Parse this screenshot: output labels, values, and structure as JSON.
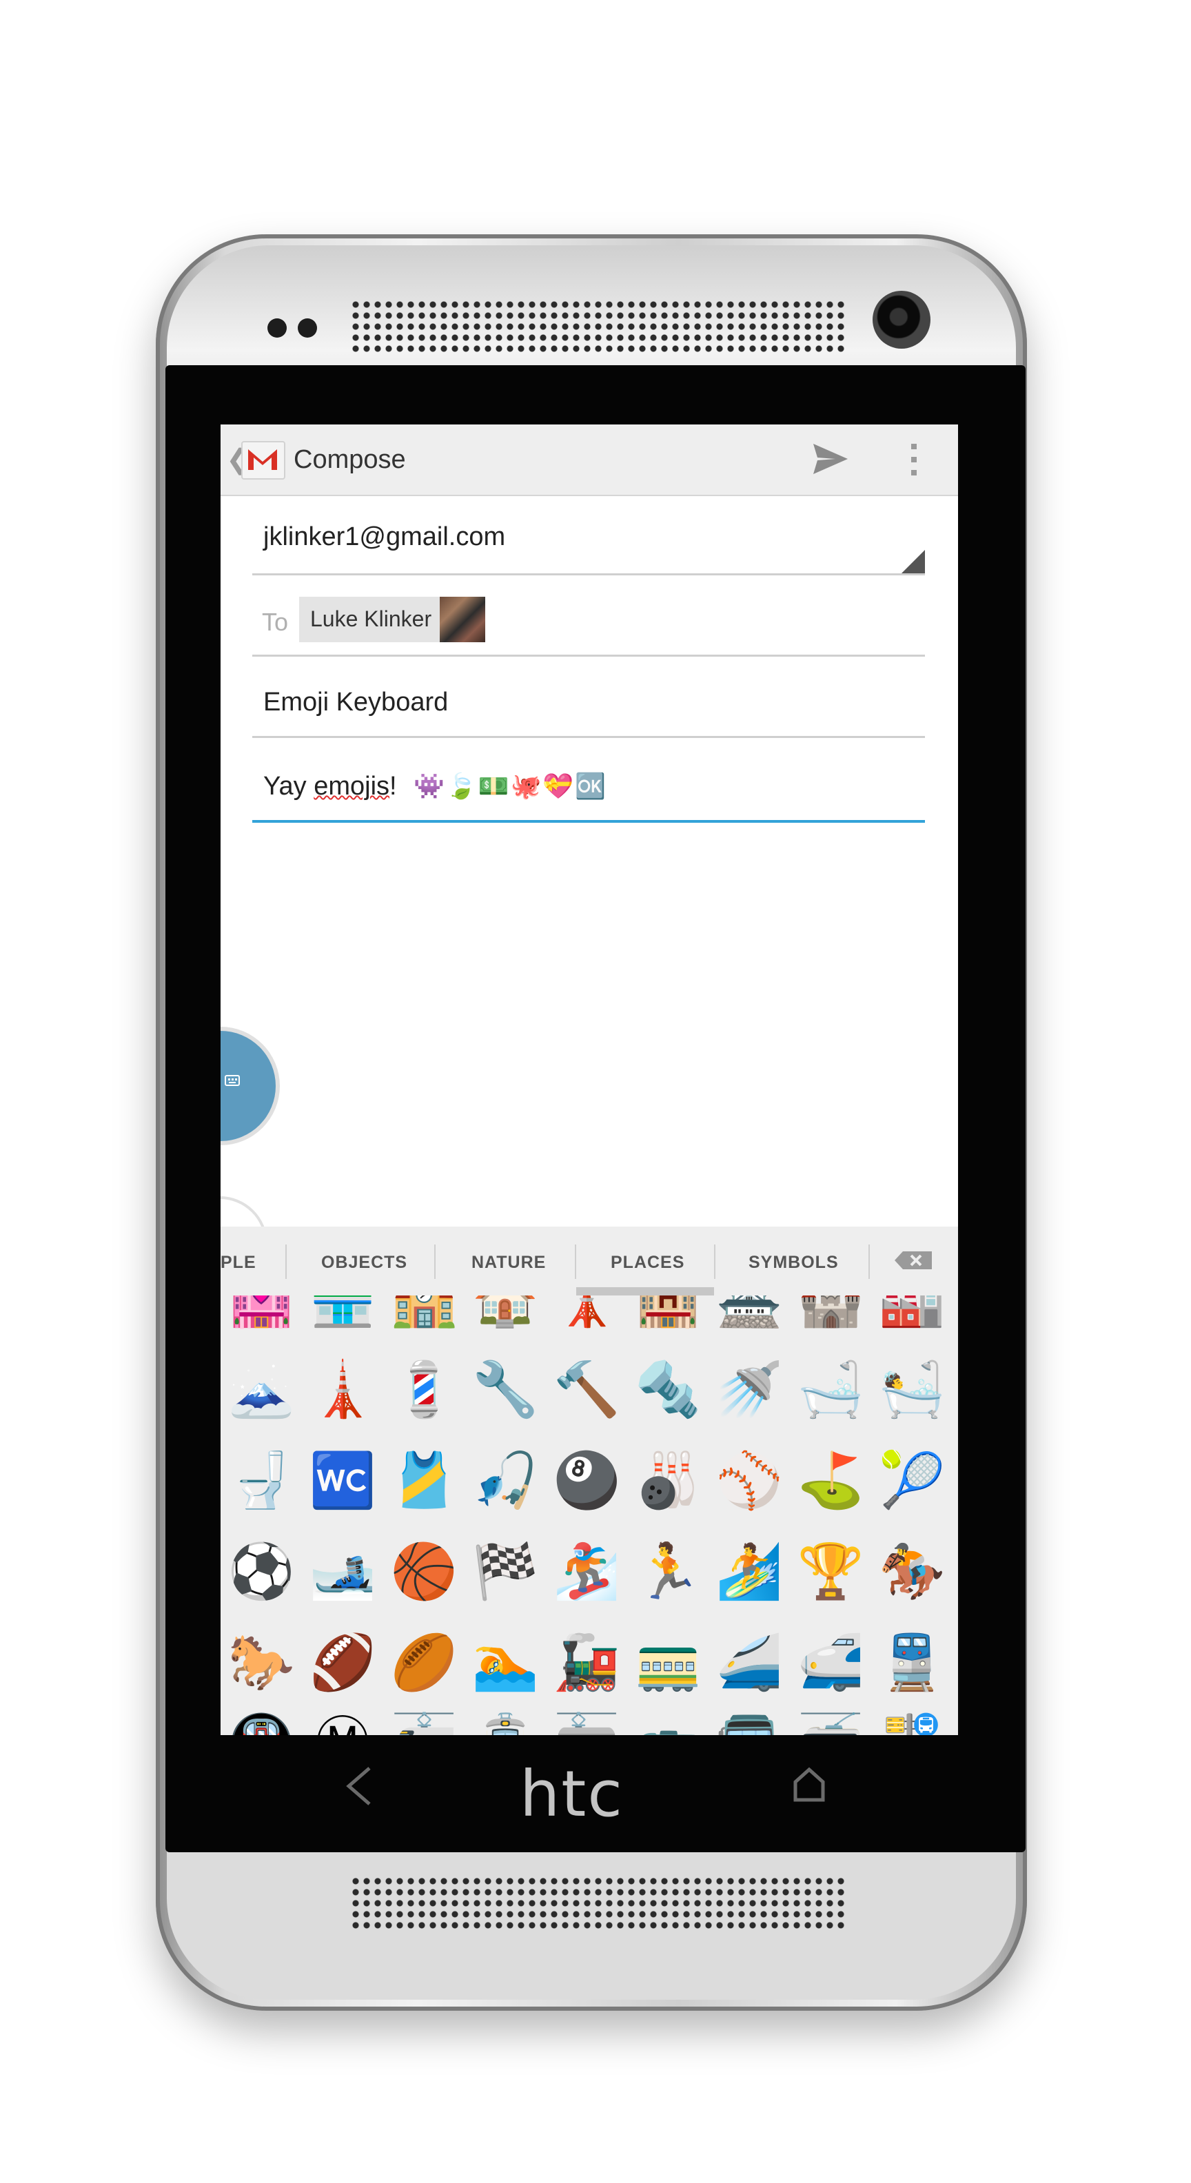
{
  "app": {
    "title": "Compose"
  },
  "compose": {
    "from": "jklinker1@gmail.com",
    "to_label": "To",
    "recipient_chip": "Luke Klinker",
    "subject": "Emoji Keyboard",
    "body_prefix": "Yay ",
    "body_misspelled": "emojis",
    "body_suffix": "!",
    "body_emojis": "👾🍃💵🐙💝🆗"
  },
  "keyboard": {
    "tabs": [
      "PLE",
      "OBJECTS",
      "NATURE",
      "PLACES",
      "SYMBOLS"
    ],
    "selected_tab": "PLACES",
    "emoji_rows": [
      [
        "🏩",
        "🏪",
        "🏫",
        "🏠",
        "🗼",
        "🏨",
        "🏯",
        "🏰",
        "🏭"
      ],
      [
        "🗻",
        "🗼",
        "💈",
        "🔧",
        "🔨",
        "🔩",
        "🚿",
        "🛁",
        "🛀"
      ],
      [
        "🚽",
        "🚾",
        "🎽",
        "🎣",
        "🎱",
        "🎳",
        "⚾",
        "⛳",
        "🎾"
      ],
      [
        "⚽",
        "🎿",
        "🏀",
        "🏁",
        "🏂",
        "🏃",
        "🏄",
        "🏆",
        "🏇"
      ],
      [
        "🐎",
        "🏈",
        "🏉",
        "🏊",
        "🚂",
        "🚃",
        "🚄",
        "🚅",
        "🚆"
      ],
      [
        "🚇",
        "Ⓜ",
        "🚈",
        "🚊",
        "🚋",
        "🚌",
        "🚍",
        "🚎",
        "🚏"
      ]
    ]
  },
  "device": {
    "brand": "htc"
  },
  "colors": {
    "accent_blue": "#33a3d9",
    "fab_blue": "#5d9bbf",
    "gmail_red": "#d93025"
  }
}
